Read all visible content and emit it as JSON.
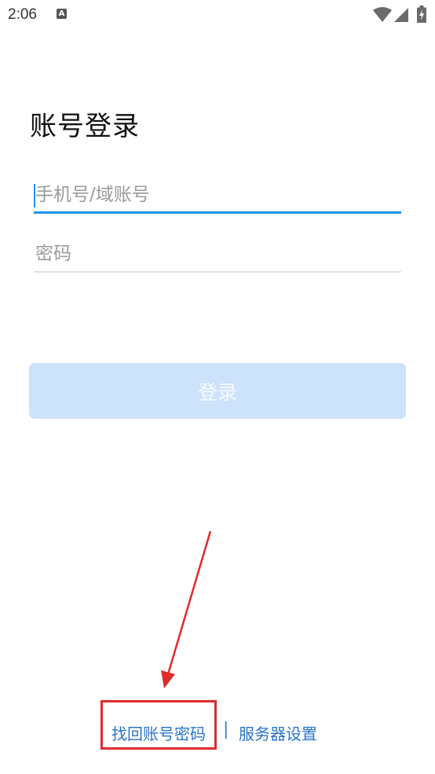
{
  "status_bar": {
    "time": "2:06",
    "app_icon_letter": "A",
    "icons": [
      "wifi-icon",
      "signal-icon",
      "battery-charging-icon"
    ]
  },
  "login": {
    "title": "账号登录",
    "phone_placeholder": "手机号/域账号",
    "phone_value": "",
    "password_placeholder": "密码",
    "password_value": "",
    "login_button_label": "登录"
  },
  "links": {
    "find_account_password": "找回账号密码",
    "separator": "|",
    "server_settings": "服务器设置"
  },
  "colors": {
    "accent": "#1a96e8",
    "button_disabled": "#cde2fb",
    "link": "#2a73c9",
    "annotation": "#e02b2b"
  }
}
